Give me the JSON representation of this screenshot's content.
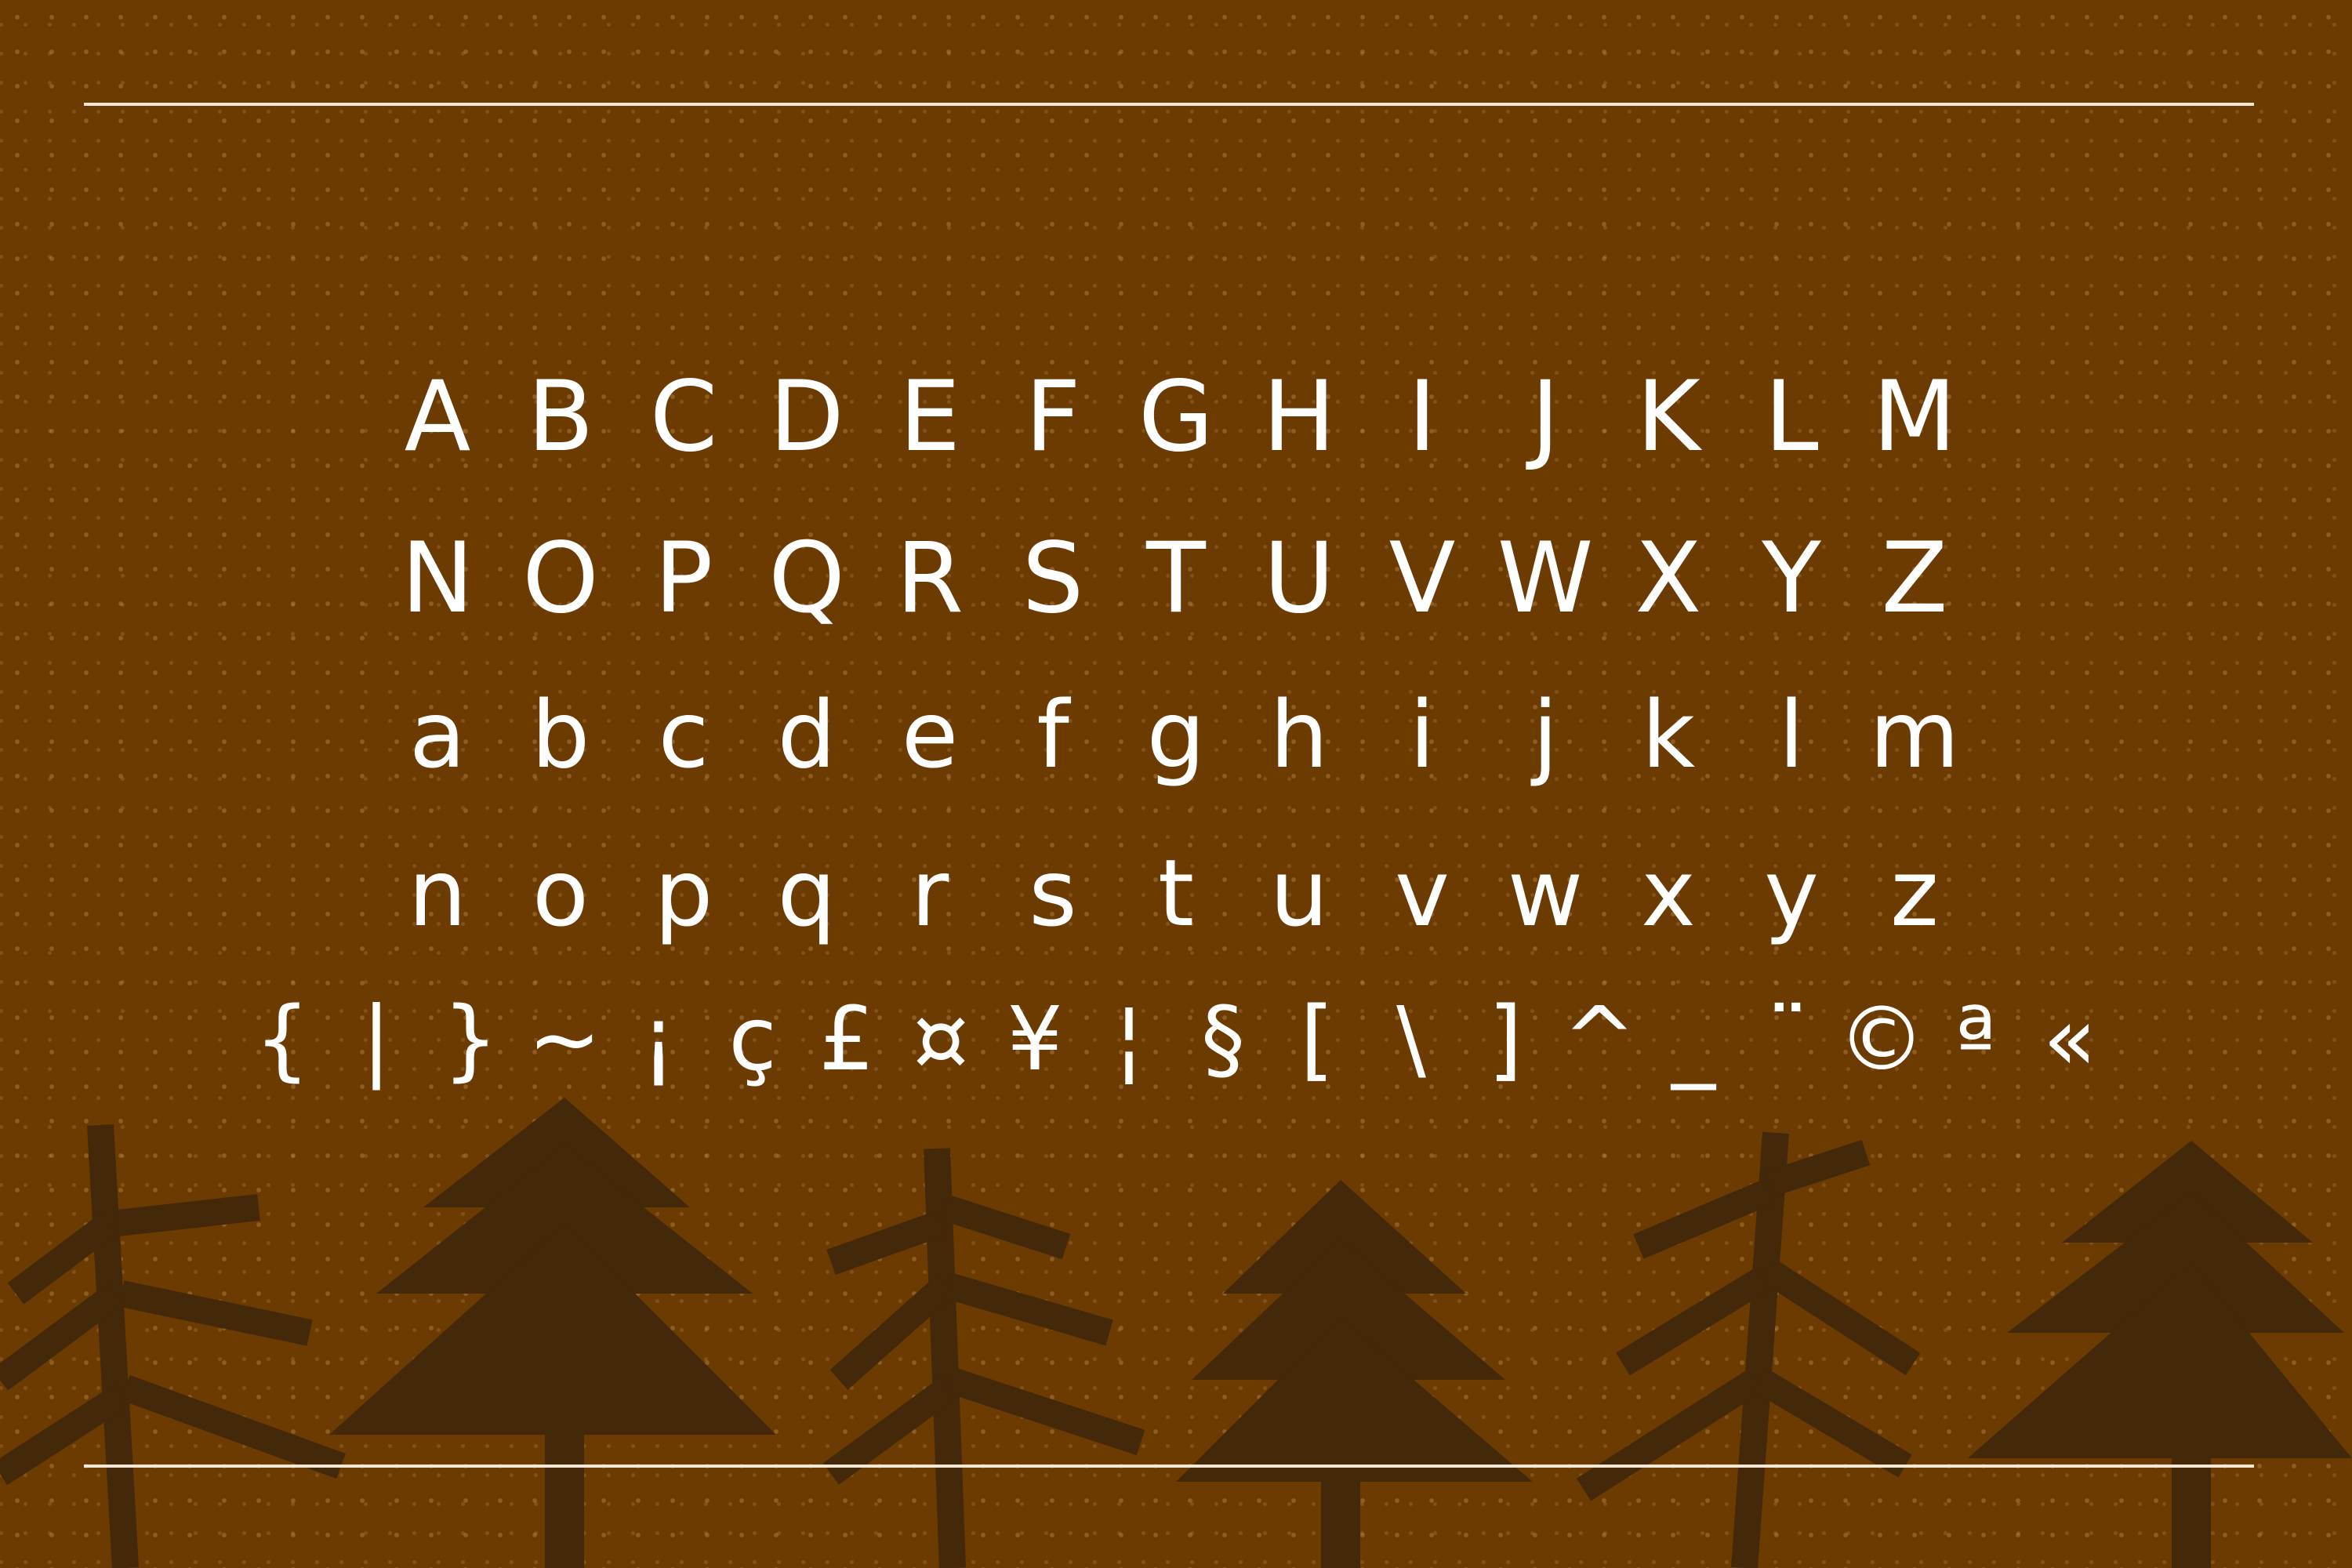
{
  "colors": {
    "background": "#6b3b02",
    "dots": "#d9a56a",
    "trees": "#43280a",
    "glyph_text": "#ffffff",
    "rule": "#f3e7d6"
  },
  "glyphs": {
    "uppercase_row_1": [
      "A",
      "B",
      "C",
      "D",
      "E",
      "F",
      "G",
      "H",
      "I",
      "J",
      "K",
      "L",
      "M"
    ],
    "uppercase_row_2": [
      "N",
      "O",
      "P",
      "Q",
      "R",
      "S",
      "T",
      "U",
      "V",
      "W",
      "X",
      "Y",
      "Z"
    ],
    "lowercase_row_1": [
      "a",
      "b",
      "c",
      "d",
      "e",
      "f",
      "g",
      "h",
      "i",
      "j",
      "k",
      "l",
      "m"
    ],
    "lowercase_row_2": [
      "n",
      "o",
      "p",
      "q",
      "r",
      "s",
      "t",
      "u",
      "v",
      "w",
      "x",
      "y",
      "z"
    ],
    "symbols_row": [
      "{",
      "|",
      "}",
      "~",
      "¡",
      "ç",
      "£",
      "¤",
      "¥",
      "¦",
      "§",
      "[",
      "\\",
      "]",
      "^",
      "_",
      "¨",
      "©",
      "ª",
      "«"
    ]
  },
  "decorations": {
    "trees": [
      "branch-tree",
      "pine-tree",
      "branch-tree",
      "pine-tree",
      "branch-tree",
      "pine-tree"
    ]
  }
}
